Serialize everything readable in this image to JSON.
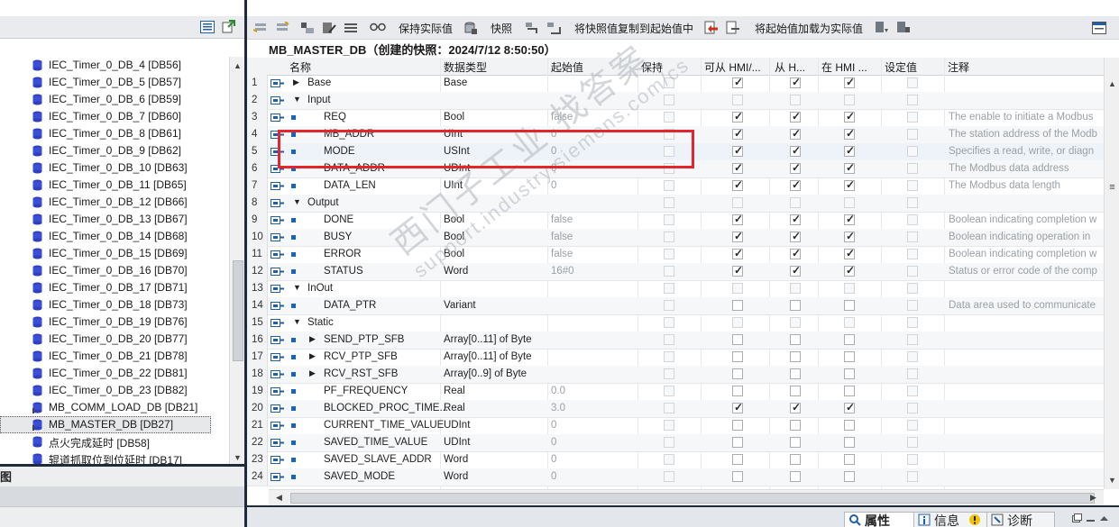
{
  "left_tree": {
    "items": [
      {
        "label": "IEC_Timer_0_DB_4 [DB56]"
      },
      {
        "label": "IEC_Timer_0_DB_5 [DB57]"
      },
      {
        "label": "IEC_Timer_0_DB_6 [DB59]"
      },
      {
        "label": "IEC_Timer_0_DB_7 [DB60]"
      },
      {
        "label": "IEC_Timer_0_DB_8 [DB61]"
      },
      {
        "label": "IEC_Timer_0_DB_9 [DB62]"
      },
      {
        "label": "IEC_Timer_0_DB_10 [DB63]"
      },
      {
        "label": "IEC_Timer_0_DB_11 [DB65]"
      },
      {
        "label": "IEC_Timer_0_DB_12 [DB66]"
      },
      {
        "label": "IEC_Timer_0_DB_13 [DB67]"
      },
      {
        "label": "IEC_Timer_0_DB_14 [DB68]"
      },
      {
        "label": "IEC_Timer_0_DB_15 [DB69]"
      },
      {
        "label": "IEC_Timer_0_DB_16 [DB70]"
      },
      {
        "label": "IEC_Timer_0_DB_17 [DB71]"
      },
      {
        "label": "IEC_Timer_0_DB_18 [DB73]"
      },
      {
        "label": "IEC_Timer_0_DB_19 [DB76]"
      },
      {
        "label": "IEC_Timer_0_DB_20 [DB77]"
      },
      {
        "label": "IEC_Timer_0_DB_21 [DB78]"
      },
      {
        "label": "IEC_Timer_0_DB_22 [DB81]"
      },
      {
        "label": "IEC_Timer_0_DB_23 [DB82]"
      },
      {
        "label": "MB_COMM_LOAD_DB [DB21]"
      },
      {
        "label": "MB_MASTER_DB [DB27]"
      },
      {
        "label": "点火完成延时 [DB58]"
      },
      {
        "label": "辊道抓取位到位延时 [DB17]"
      }
    ],
    "selected_index": 21
  },
  "left_bottom": {
    "overview_label": "图"
  },
  "toolbar": {
    "keep_actual_label": "保持实际值",
    "snapshot_label": "快照",
    "copy_snapshot_label": "将快照值复制到起始值中",
    "load_start_label": "将起始值加载为实际值"
  },
  "editor": {
    "title": "MB_MASTER_DB（创建的快照：2024/7/12 8:50:50）"
  },
  "grid": {
    "headers": {
      "name": "名称",
      "datatype": "数据类型",
      "start": "起始值",
      "retain": "保持",
      "hmi_access": "可从 HMI/...",
      "hmi_visible": "从 H...",
      "hmi_settable": "在 HMI ...",
      "setpoint": "设定值",
      "comment": "注释"
    },
    "rows": [
      {
        "n": "1",
        "name": "Base",
        "type": "Base",
        "start": "",
        "level": 0,
        "expand": "collapsed",
        "retain": false,
        "hmi1": true,
        "hmi2": true,
        "hmi3": true,
        "set": false,
        "comment": ""
      },
      {
        "n": "2",
        "name": "Input",
        "type": "",
        "start": "",
        "level": 0,
        "expand": "expanded",
        "retain": false,
        "hmi1": false,
        "hmi2": false,
        "hmi3": false,
        "set": false,
        "comment": ""
      },
      {
        "n": "3",
        "name": "REQ",
        "type": "Bool",
        "start": "false",
        "level": 1,
        "expand": "none",
        "retain": false,
        "hmi1": true,
        "hmi2": true,
        "hmi3": true,
        "set": false,
        "comment": "The enable to initiate a Modbus"
      },
      {
        "n": "4",
        "name": "MB_ADDR",
        "type": "UInt",
        "start": "0",
        "level": 1,
        "expand": "none",
        "retain": false,
        "hmi1": true,
        "hmi2": true,
        "hmi3": true,
        "set": false,
        "comment": "The station address of the Modb"
      },
      {
        "n": "5",
        "name": "MODE",
        "type": "USInt",
        "start": "0",
        "level": 1,
        "expand": "none",
        "retain": false,
        "hmi1": true,
        "hmi2": true,
        "hmi3": true,
        "set": false,
        "comment": "Specifies a read, write, or diagn"
      },
      {
        "n": "6",
        "name": "DATA_ADDR",
        "type": "UDInt",
        "start": "0",
        "level": 1,
        "expand": "none",
        "retain": false,
        "hmi1": true,
        "hmi2": true,
        "hmi3": true,
        "set": false,
        "comment": "The Modbus data address"
      },
      {
        "n": "7",
        "name": "DATA_LEN",
        "type": "UInt",
        "start": "0",
        "level": 1,
        "expand": "none",
        "retain": false,
        "hmi1": true,
        "hmi2": true,
        "hmi3": true,
        "set": false,
        "comment": "The Modbus data length"
      },
      {
        "n": "8",
        "name": "Output",
        "type": "",
        "start": "",
        "level": 0,
        "expand": "expanded",
        "retain": false,
        "hmi1": false,
        "hmi2": false,
        "hmi3": false,
        "set": false,
        "comment": ""
      },
      {
        "n": "9",
        "name": "DONE",
        "type": "Bool",
        "start": "false",
        "level": 1,
        "expand": "none",
        "retain": false,
        "hmi1": true,
        "hmi2": true,
        "hmi3": true,
        "set": false,
        "comment": "Boolean indicating completion w"
      },
      {
        "n": "10",
        "name": "BUSY",
        "type": "Bool",
        "start": "false",
        "level": 1,
        "expand": "none",
        "retain": false,
        "hmi1": true,
        "hmi2": true,
        "hmi3": true,
        "set": false,
        "comment": "Boolean indicating operation in"
      },
      {
        "n": "11",
        "name": "ERROR",
        "type": "Bool",
        "start": "false",
        "level": 1,
        "expand": "none",
        "retain": false,
        "hmi1": true,
        "hmi2": true,
        "hmi3": true,
        "set": false,
        "comment": "Boolean indicating completion w"
      },
      {
        "n": "12",
        "name": "STATUS",
        "type": "Word",
        "start": "16#0",
        "level": 1,
        "expand": "none",
        "retain": false,
        "hmi1": true,
        "hmi2": true,
        "hmi3": true,
        "set": false,
        "comment": "Status or error code of the comp"
      },
      {
        "n": "13",
        "name": "InOut",
        "type": "",
        "start": "",
        "level": 0,
        "expand": "expanded",
        "retain": false,
        "hmi1": false,
        "hmi2": false,
        "hmi3": false,
        "set": false,
        "comment": ""
      },
      {
        "n": "14",
        "name": "DATA_PTR",
        "type": "Variant",
        "start": "",
        "level": 1,
        "expand": "none",
        "retain": false,
        "hmi1": false,
        "hmi2": false,
        "hmi3": false,
        "set": false,
        "comment": "Data area used to communicate"
      },
      {
        "n": "15",
        "name": "Static",
        "type": "",
        "start": "",
        "level": 0,
        "expand": "expanded",
        "retain": false,
        "hmi1": false,
        "hmi2": false,
        "hmi3": false,
        "set": false,
        "comment": ""
      },
      {
        "n": "16",
        "name": "SEND_PTP_SFB",
        "type": "Array[0..11] of Byte",
        "start": "",
        "level": 1,
        "expand": "collapsed",
        "retain": false,
        "hmi1": false,
        "hmi2": false,
        "hmi3": false,
        "set": false,
        "comment": ""
      },
      {
        "n": "17",
        "name": "RCV_PTP_SFB",
        "type": "Array[0..11] of Byte",
        "start": "",
        "level": 1,
        "expand": "collapsed",
        "retain": false,
        "hmi1": false,
        "hmi2": false,
        "hmi3": false,
        "set": false,
        "comment": ""
      },
      {
        "n": "18",
        "name": "RCV_RST_SFB",
        "type": "Array[0..9] of Byte",
        "start": "",
        "level": 1,
        "expand": "collapsed",
        "retain": false,
        "hmi1": false,
        "hmi2": false,
        "hmi3": false,
        "set": false,
        "comment": ""
      },
      {
        "n": "19",
        "name": "PF_FREQUENCY",
        "type": "Real",
        "start": "0.0",
        "level": 1,
        "expand": "none",
        "retain": false,
        "hmi1": false,
        "hmi2": false,
        "hmi3": false,
        "set": false,
        "comment": ""
      },
      {
        "n": "20",
        "name": "BLOCKED_PROC_TIME...",
        "type": "Real",
        "start": "3.0",
        "level": 1,
        "expand": "none",
        "retain": false,
        "hmi1": true,
        "hmi2": true,
        "hmi3": true,
        "set": false,
        "comment": ""
      },
      {
        "n": "21",
        "name": "CURRENT_TIME_VALUE",
        "type": "UDInt",
        "start": "0",
        "level": 1,
        "expand": "none",
        "retain": false,
        "hmi1": false,
        "hmi2": false,
        "hmi3": false,
        "set": false,
        "comment": ""
      },
      {
        "n": "22",
        "name": "SAVED_TIME_VALUE",
        "type": "UDInt",
        "start": "0",
        "level": 1,
        "expand": "none",
        "retain": false,
        "hmi1": false,
        "hmi2": false,
        "hmi3": false,
        "set": false,
        "comment": ""
      },
      {
        "n": "23",
        "name": "SAVED_SLAVE_ADDR",
        "type": "Word",
        "start": "0",
        "level": 1,
        "expand": "none",
        "retain": false,
        "hmi1": false,
        "hmi2": false,
        "hmi3": false,
        "set": false,
        "comment": ""
      },
      {
        "n": "24",
        "name": "SAVED_MODE",
        "type": "Word",
        "start": "0",
        "level": 1,
        "expand": "none",
        "retain": false,
        "hmi1": false,
        "hmi2": false,
        "hmi3": false,
        "set": false,
        "comment": ""
      }
    ]
  },
  "statusbar": {
    "properties_label": "属性",
    "info_label": "信息",
    "diagnostics_label": "诊断"
  },
  "watermark": {
    "line1": "西门子工业 找答案",
    "line2": "support.industry.siemens.com/cs"
  },
  "colors": {
    "accent_blue": "#1565c0",
    "highlight_red": "#e3262d",
    "dark_frame": "#1f2a3a"
  }
}
